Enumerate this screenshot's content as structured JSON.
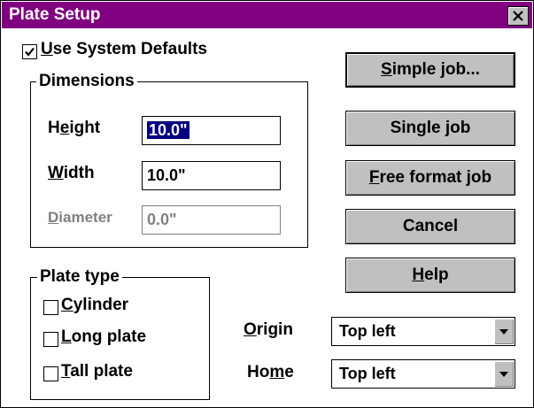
{
  "window": {
    "title": "Plate Setup",
    "close_icon": "close-icon"
  },
  "defaults": {
    "use_system_defaults": {
      "label_mnemonic": "U",
      "label_rest": "se System Defaults",
      "checked": true
    }
  },
  "dimensions": {
    "legend": "Dimensions",
    "height": {
      "label_pre": "H",
      "label_mnemonic": "e",
      "label_rest": "ight",
      "value": "10.0\""
    },
    "width": {
      "label_mnemonic": "W",
      "label_rest": "idth",
      "value": "10.0\""
    },
    "diameter": {
      "label_mnemonic": "D",
      "label_rest": "iameter",
      "value": "0.0\"",
      "enabled": false
    }
  },
  "plate_type": {
    "legend": "Plate type",
    "options": [
      {
        "mnemonic": "C",
        "rest": "ylinder",
        "checked": false
      },
      {
        "mnemonic": "L",
        "rest": "ong plate",
        "checked": false
      },
      {
        "mnemonic": "T",
        "rest": "all plate",
        "checked": false
      }
    ]
  },
  "buttons": {
    "simple_job": {
      "mnemonic": "S",
      "rest": "imple job..."
    },
    "single_job": {
      "pre": "Single ",
      "mnemonic": "j",
      "rest": "ob"
    },
    "free_format_job": {
      "mnemonic": "F",
      "rest": "ree format job"
    },
    "cancel": {
      "label": "Cancel"
    },
    "help": {
      "mnemonic": "H",
      "rest": "elp"
    }
  },
  "origin": {
    "label_mnemonic": "O",
    "label_rest": "rigin",
    "value": "Top left"
  },
  "home": {
    "label_pre": "Ho",
    "label_mnemonic": "m",
    "label_rest": "e",
    "value": "Top left"
  },
  "colors": {
    "titlebar": "#800080",
    "selection": "#000080",
    "button_face": "#c0c0c0"
  }
}
